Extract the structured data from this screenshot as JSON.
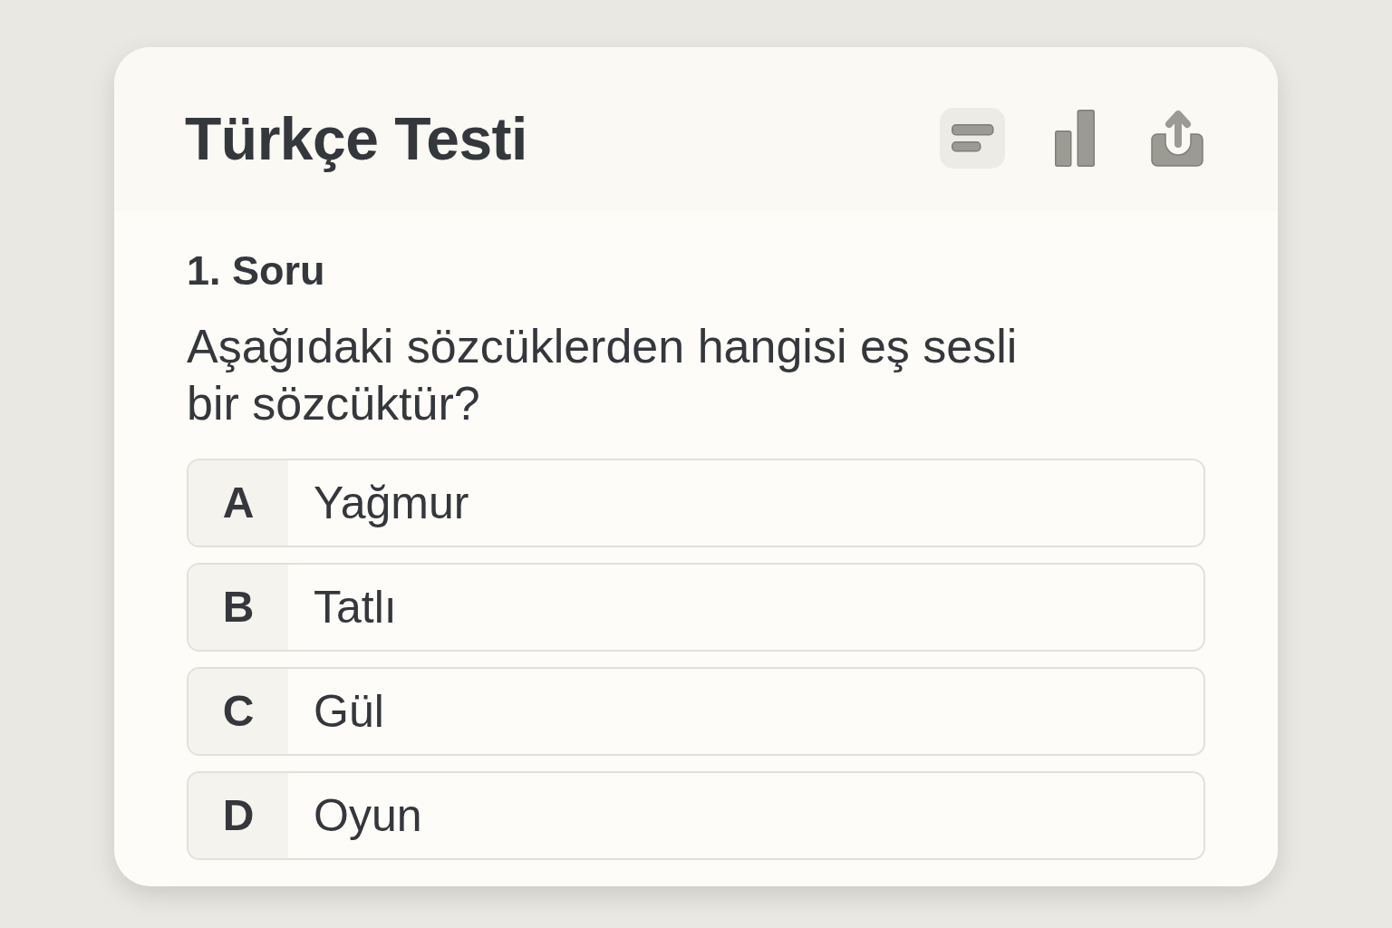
{
  "header": {
    "title": "Türkçe Testi",
    "toolbar": [
      {
        "kind": "lines",
        "selected": true
      },
      {
        "kind": "bar-chart",
        "selected": false
      },
      {
        "kind": "share",
        "selected": false
      }
    ]
  },
  "question": {
    "number": "1. Soru",
    "text": "Aşağıdaki sözcüklerden hangisi eş sesli bir sözcüktür?",
    "options": [
      {
        "letter": "A",
        "text": "Yağmur"
      },
      {
        "letter": "B",
        "text": "Tatlı"
      },
      {
        "letter": "C",
        "text": "Gül"
      },
      {
        "letter": "D",
        "text": "Oyun"
      }
    ]
  }
}
